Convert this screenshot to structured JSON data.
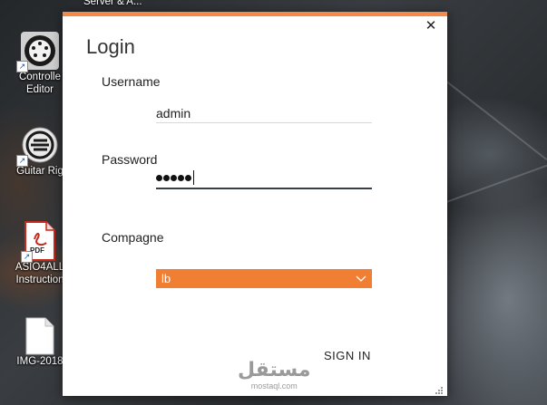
{
  "desktop": {
    "top_partial_label": "Server & A...",
    "icons": [
      {
        "label_line1": "Controlle",
        "label_line2": "Editor",
        "icon": "midi-controller-icon"
      },
      {
        "label_line1": "Guitar Rig",
        "label_line2": "",
        "icon": "guitar-rig-icon"
      },
      {
        "label_line1": "ASIO4ALL",
        "label_line2": "Instruction",
        "icon": "pdf-icon",
        "badge": "PDF"
      },
      {
        "label_line1": "IMG-2018",
        "label_line2": "",
        "icon": "image-file-icon"
      }
    ]
  },
  "dialog": {
    "title": "Login",
    "close_glyph": "✕",
    "username": {
      "label": "Username",
      "value": "admin"
    },
    "password": {
      "label": "Password",
      "masked_length": 5
    },
    "company": {
      "label": "Compagne",
      "selected": "lb"
    },
    "sign_in_label": "SIGN IN"
  },
  "colors": {
    "accent": "#f5894a",
    "select_bg": "#f07e33",
    "focus_underline": "#3a3f47"
  },
  "watermark": {
    "text": "مستقل",
    "sub": "mostaql.com"
  }
}
